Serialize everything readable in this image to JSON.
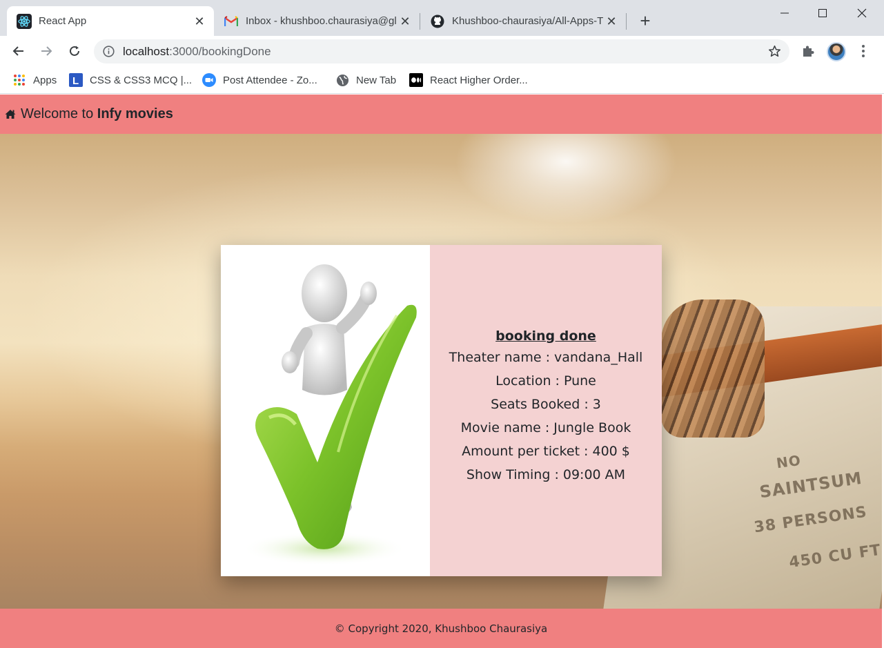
{
  "browser": {
    "tabs": [
      {
        "title": "React App",
        "icon": "react-icon",
        "active": true
      },
      {
        "title": "Inbox - khushboo.chaurasiya@gl",
        "icon": "gmail-icon",
        "active": false
      },
      {
        "title": "Khushboo-chaurasiya/All-Apps-T",
        "icon": "github-icon",
        "active": false
      }
    ],
    "new_tab_label": "+",
    "url_host": "localhost",
    "url_path": ":3000/bookingDone",
    "bookmarks": [
      {
        "label": "Apps",
        "icon": "apps-grid-icon"
      },
      {
        "label": "CSS & CSS3 MCQ |...",
        "icon": "l-icon"
      },
      {
        "label": "Post Attendee - Zo...",
        "icon": "zoom-icon"
      },
      {
        "label": "New Tab",
        "icon": "globe-icon"
      },
      {
        "label": "React Higher Order...",
        "icon": "medium-icon"
      }
    ]
  },
  "app": {
    "navbar": {
      "prefix": "Welcome to ",
      "brand": "Infy movies",
      "icon": "home-icon",
      "color": "#f08080"
    },
    "booking": {
      "heading": "booking done",
      "details": [
        "Theater name : vandana_Hall",
        "Location : Pune",
        "Seats Booked : 3",
        "Movie name : Jungle Book",
        "Amount per ticket : 400 $",
        "Show Timing : 09:00 AM"
      ],
      "panel_color": "#f4d2d2"
    },
    "background_text": {
      "line1": "NO",
      "line2": "SAINTSUM",
      "line3": "38 PERSONS",
      "line4": "450 CU FT"
    },
    "footer": {
      "text": "© Copyright 2020, Khushboo Chaurasiya"
    }
  }
}
